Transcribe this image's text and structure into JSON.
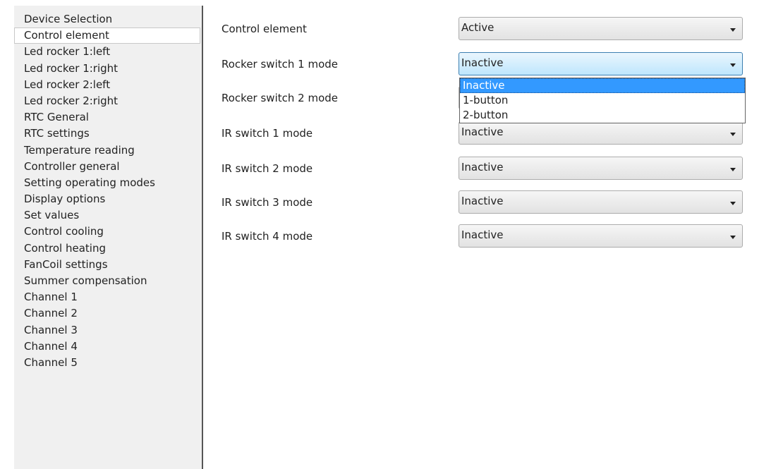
{
  "sidebar": {
    "items": [
      {
        "label": "Device Selection",
        "selected": false
      },
      {
        "label": "Control element",
        "selected": true
      },
      {
        "label": "Led rocker 1:left",
        "selected": false
      },
      {
        "label": "Led rocker 1:right",
        "selected": false
      },
      {
        "label": "Led rocker 2:left",
        "selected": false
      },
      {
        "label": "Led rocker 2:right",
        "selected": false
      },
      {
        "label": "RTC General",
        "selected": false
      },
      {
        "label": "RTC settings",
        "selected": false
      },
      {
        "label": "Temperature reading",
        "selected": false
      },
      {
        "label": "Controller general",
        "selected": false
      },
      {
        "label": "Setting operating modes",
        "selected": false
      },
      {
        "label": "Display options",
        "selected": false
      },
      {
        "label": "Set values",
        "selected": false
      },
      {
        "label": "Control cooling",
        "selected": false
      },
      {
        "label": "Control heating",
        "selected": false
      },
      {
        "label": "FanCoil settings",
        "selected": false
      },
      {
        "label": "Summer compensation",
        "selected": false
      },
      {
        "label": "Channel 1",
        "selected": false
      },
      {
        "label": "Channel 2",
        "selected": false
      },
      {
        "label": "Channel 3",
        "selected": false
      },
      {
        "label": "Channel 4",
        "selected": false
      },
      {
        "label": "Channel 5",
        "selected": false
      }
    ]
  },
  "form": {
    "rows": [
      {
        "label": "Control element",
        "value": "Active",
        "open": false
      },
      {
        "label": "Rocker switch 1 mode",
        "value": "Inactive",
        "open": true
      },
      {
        "label": "Rocker switch 2 mode",
        "value": "",
        "open": false
      },
      {
        "label": "IR switch 1 mode",
        "value": "Inactive",
        "open": false
      },
      {
        "label": "IR switch 2 mode",
        "value": "Inactive",
        "open": false
      },
      {
        "label": "IR switch 3 mode",
        "value": "Inactive",
        "open": false
      },
      {
        "label": "IR switch 4 mode",
        "value": "Inactive",
        "open": false
      }
    ],
    "dropdown": {
      "options": [
        "Inactive",
        "1-button",
        "2-button"
      ],
      "highlighted_index": 0
    }
  },
  "colors": {
    "sidebar_bg": "#f0f0f0",
    "highlight": "#3399ff",
    "open_combo_border": "#3c7fb1"
  }
}
